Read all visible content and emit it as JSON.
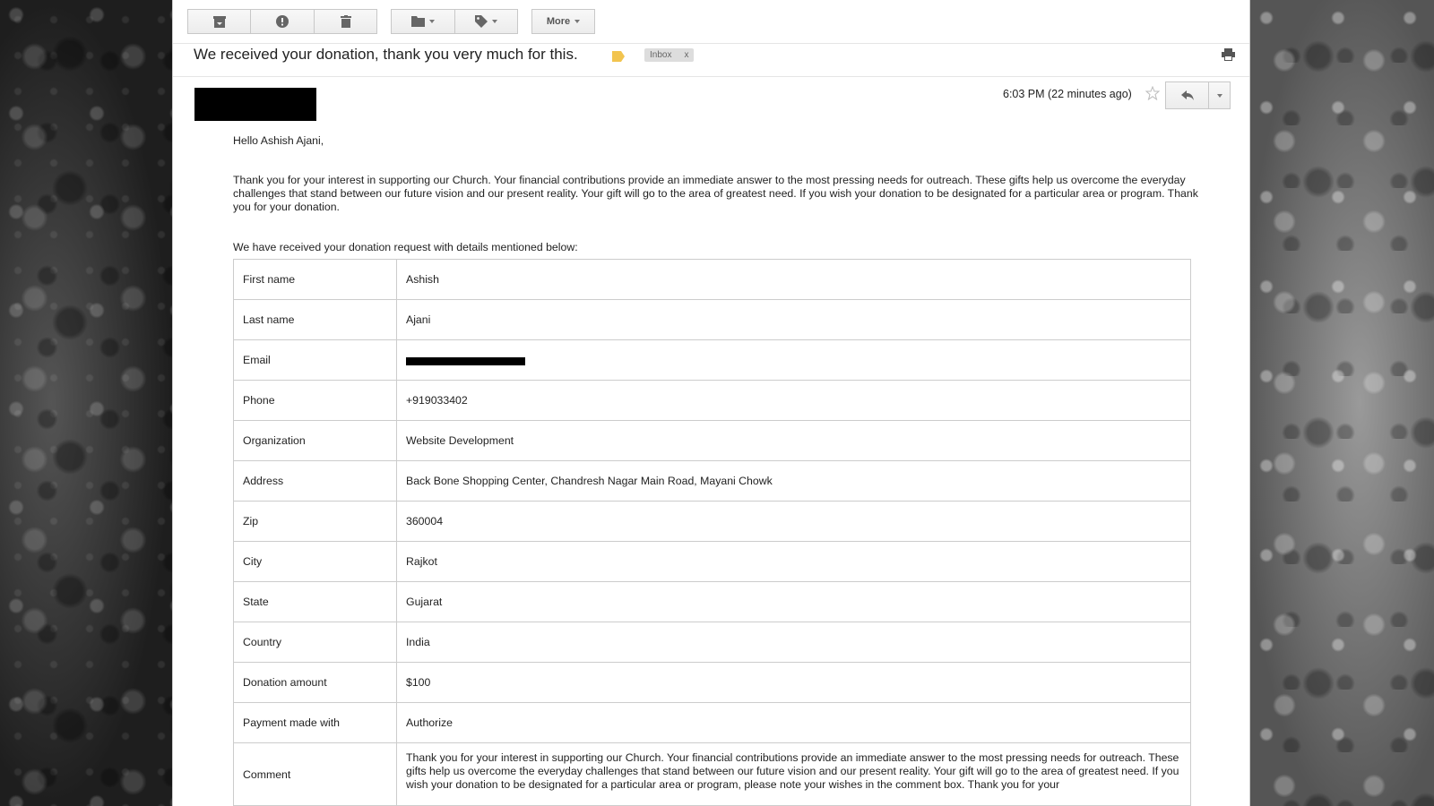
{
  "toolbar": {
    "archive": "archive-icon",
    "spam": "report-spam-icon",
    "delete": "trash-icon",
    "move": "folder-icon",
    "labels": "label-icon",
    "more_label": "More"
  },
  "message": {
    "subject": "We received your donation, thank you very much for this.",
    "label_chip": "Inbox",
    "label_chip_close": "x",
    "timestamp": "6:03 PM (22 minutes ago)",
    "greeting": "Hello Ashish Ajani,",
    "paragraph1": "Thank you for your interest in supporting our Church. Your financial contributions provide an immediate answer to the most pressing needs for outreach. These gifts help us overcome the everyday challenges that stand between our future vision and our present reality. Your gift will go to the area of greatest need. If you wish your donation to be designated for a particular area or program. Thank you for your donation.",
    "paragraph2": "We have received your donation request with details mentioned below:"
  },
  "details": [
    {
      "label": "First name",
      "value": "Ashish"
    },
    {
      "label": "Last name",
      "value": "Ajani"
    },
    {
      "label": "Email",
      "value": ""
    },
    {
      "label": "Phone",
      "value": "+919033402"
    },
    {
      "label": "Organization",
      "value": "Website Development"
    },
    {
      "label": "Address",
      "value": "Back Bone Shopping Center, Chandresh Nagar Main Road, Mayani Chowk"
    },
    {
      "label": "Zip",
      "value": "360004"
    },
    {
      "label": "City",
      "value": "Rajkot"
    },
    {
      "label": "State",
      "value": "Gujarat"
    },
    {
      "label": "Country",
      "value": "India"
    },
    {
      "label": "Donation amount",
      "value": "$100"
    },
    {
      "label": "Payment made with",
      "value": "Authorize"
    },
    {
      "label": "Comment",
      "value": "Thank you for your interest in supporting our Church. Your financial contributions provide an immediate answer to the most pressing needs for outreach. These gifts help us overcome the everyday challenges that stand between our future vision and our present reality. Your gift will go to the area of greatest need. If you wish your donation to be designated for a particular area or program, please note your wishes in the comment box. Thank you for your"
    }
  ],
  "colors": {
    "label_tag": "#f2c44f",
    "link": "#1155cc"
  }
}
